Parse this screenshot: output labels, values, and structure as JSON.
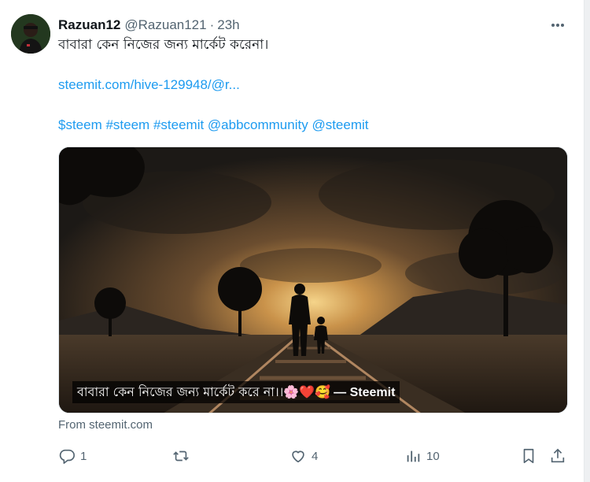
{
  "tweet": {
    "display_name": "Razuan12",
    "handle": "@Razuan121",
    "separator": "·",
    "time": "23h",
    "text_line": "বাবারা কেন নিজের জন্য মার্কেট করেনা।",
    "link_text": "steemit.com/hive-129948/@r...",
    "hashtags_line": "$steem #steem #steemit @abbcommunity @steemit",
    "media_caption": "বাবারা কেন নিজের জন্য মার্কেট করে না।।🌸❤️🥰",
    "media_caption_source": "— Steemit",
    "from_label": "From steemit.com"
  },
  "actions": {
    "reply_count": "1",
    "retweet_count": "",
    "like_count": "4",
    "views_count": "10"
  },
  "icons": {
    "more": "more-horizontal-icon",
    "reply": "reply-icon",
    "retweet": "retweet-icon",
    "like": "heart-icon",
    "views": "views-chart-icon",
    "bookmark": "bookmark-icon",
    "share": "share-icon"
  },
  "colors": {
    "link": "#1d9bf0",
    "secondary_text": "#536471",
    "primary_text": "#0f1419"
  }
}
